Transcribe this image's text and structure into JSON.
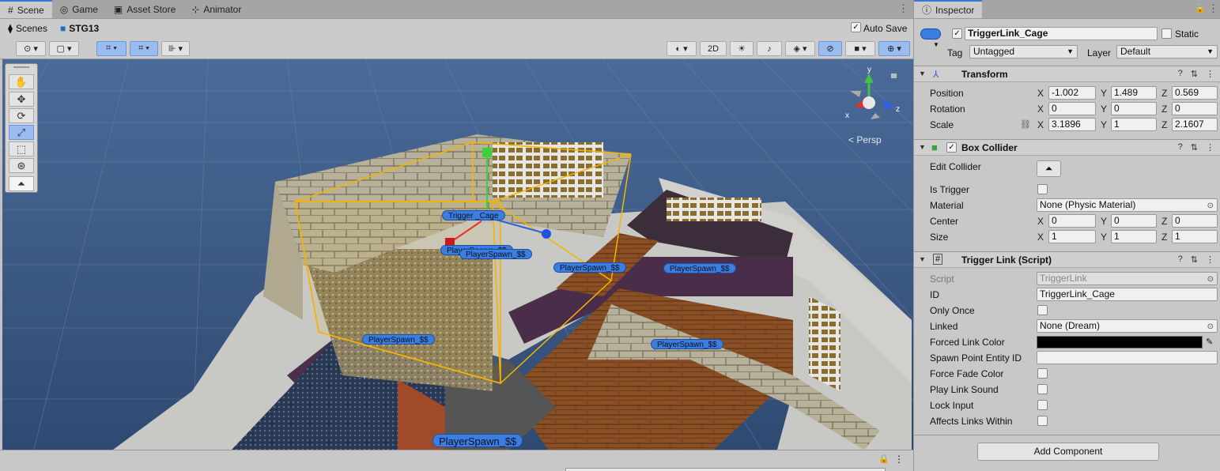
{
  "left_tabs": [
    {
      "label": "Scene",
      "icon": "grid-icon"
    },
    {
      "label": "Game",
      "icon": "gamepad-icon"
    },
    {
      "label": "Asset Store",
      "icon": "bag-icon"
    },
    {
      "label": "Animator",
      "icon": "animator-icon"
    }
  ],
  "breadcrumb": {
    "root": "Scenes",
    "current": "STG13"
  },
  "auto_save": {
    "label": "Auto Save",
    "checked": true
  },
  "toolbar": {
    "mode_2d": "2D"
  },
  "viewport": {
    "persp_label": "< Persp",
    "gizmo_axes": {
      "x": "x",
      "y": "y",
      "z": "z"
    },
    "labels": [
      "Trigger     _Cage",
      "PlayerSpawn_$$",
      "PlayerSpawn_$$",
      "PlayerSpawn_$$",
      "PlayerSpawn_$$",
      "PlayerSpawn_$$",
      "PlayerSpawn_$$"
    ]
  },
  "inspector": {
    "tab": "Inspector",
    "object_name": "TriggerLink_Cage",
    "active": true,
    "static_label": "Static",
    "tag_label": "Tag",
    "tag_value": "Untagged",
    "layer_label": "Layer",
    "layer_value": "Default",
    "transform": {
      "title": "Transform",
      "position": {
        "label": "Position",
        "x": "-1.002",
        "y": "1.489",
        "z": "0.569"
      },
      "rotation": {
        "label": "Rotation",
        "x": "0",
        "y": "0",
        "z": "0"
      },
      "scale": {
        "label": "Scale",
        "x": "3.1896",
        "y": "1",
        "z": "2.1607"
      }
    },
    "box_collider": {
      "title": "Box Collider",
      "enabled": true,
      "edit_collider": "Edit Collider",
      "is_trigger": "Is Trigger",
      "material_label": "Material",
      "material_value": "None (Physic Material)",
      "center": {
        "label": "Center",
        "x": "0",
        "y": "0",
        "z": "0"
      },
      "size": {
        "label": "Size",
        "x": "1",
        "y": "1",
        "z": "1"
      }
    },
    "trigger_link": {
      "title": "Trigger Link (Script)",
      "script_label": "Script",
      "script_value": "TriggerLink",
      "id_label": "ID",
      "id_value": "TriggerLink_Cage",
      "only_once": "Only Once",
      "linked_label": "Linked",
      "linked_value": "None (Dream)",
      "forced_link_color": "Forced Link Color",
      "forced_link_color_value": "#000000",
      "spawn_point": "Spawn Point Entity ID",
      "force_fade": "Force Fade Color",
      "play_link_sound": "Play Link Sound",
      "lock_input": "Lock Input",
      "affects_links": "Affects Links Within"
    },
    "add_component": "Add Component"
  },
  "colors": {
    "accent": "#3a79d8",
    "sky": "#3d5a86",
    "selection": "#f5b400"
  }
}
